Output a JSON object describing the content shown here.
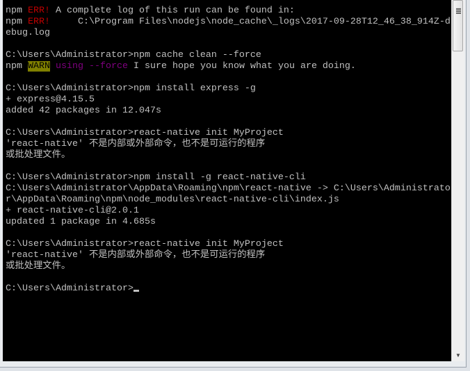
{
  "colors": {
    "background": "#000000",
    "text": "#c0c0c0",
    "err": "#c00000",
    "warn_bg": "#808000",
    "magenta": "#800080"
  },
  "lines": [
    [
      {
        "t": "npm "
      },
      {
        "t": "ERR!",
        "c": "err"
      },
      {
        "t": " A complete log of this run can be found in:"
      }
    ],
    [
      {
        "t": "npm "
      },
      {
        "t": "ERR!",
        "c": "err"
      },
      {
        "t": "     C:\\Program Files\\nodejs\\node_cache\\_logs\\2017-09-28T12_46_38_914Z-d"
      }
    ],
    [
      {
        "t": "ebug.log"
      }
    ],
    [],
    [
      {
        "t": "C:\\Users\\Administrator>npm cache clean --force"
      }
    ],
    [
      {
        "t": "npm "
      },
      {
        "t": "WARN",
        "c": "warn"
      },
      {
        "t": " "
      },
      {
        "t": "using",
        "c": "mag"
      },
      {
        "t": " "
      },
      {
        "t": "--force",
        "c": "mag"
      },
      {
        "t": " I sure hope you know what you are doing."
      }
    ],
    [],
    [
      {
        "t": "C:\\Users\\Administrator>npm install express -g"
      }
    ],
    [
      {
        "t": "+ express@4.15.5"
      }
    ],
    [
      {
        "t": "added 42 packages in 12.047s"
      }
    ],
    [],
    [
      {
        "t": "C:\\Users\\Administrator>react-native init MyProject"
      }
    ],
    [
      {
        "t": "'react-native' 不是内部或外部命令，也不是可运行的程序"
      }
    ],
    [
      {
        "t": "或批处理文件。"
      }
    ],
    [],
    [
      {
        "t": "C:\\Users\\Administrator>npm install -g react-native-cli"
      }
    ],
    [
      {
        "t": "C:\\Users\\Administrator\\AppData\\Roaming\\npm\\react-native -> C:\\Users\\Administrato"
      }
    ],
    [
      {
        "t": "r\\AppData\\Roaming\\npm\\node_modules\\react-native-cli\\index.js"
      }
    ],
    [
      {
        "t": "+ react-native-cli@2.0.1"
      }
    ],
    [
      {
        "t": "updated 1 package in 4.685s"
      }
    ],
    [],
    [
      {
        "t": "C:\\Users\\Administrator>react-native init MyProject"
      }
    ],
    [
      {
        "t": "'react-native' 不是内部或外部命令，也不是可运行的程序"
      }
    ],
    [
      {
        "t": "或批处理文件。"
      }
    ],
    [],
    [
      {
        "t": "C:\\Users\\Administrator>"
      },
      {
        "cursor": true
      }
    ]
  ],
  "icons": {
    "scroll_grip": "grip-icon",
    "scroll_down": "arrow-down-icon"
  }
}
